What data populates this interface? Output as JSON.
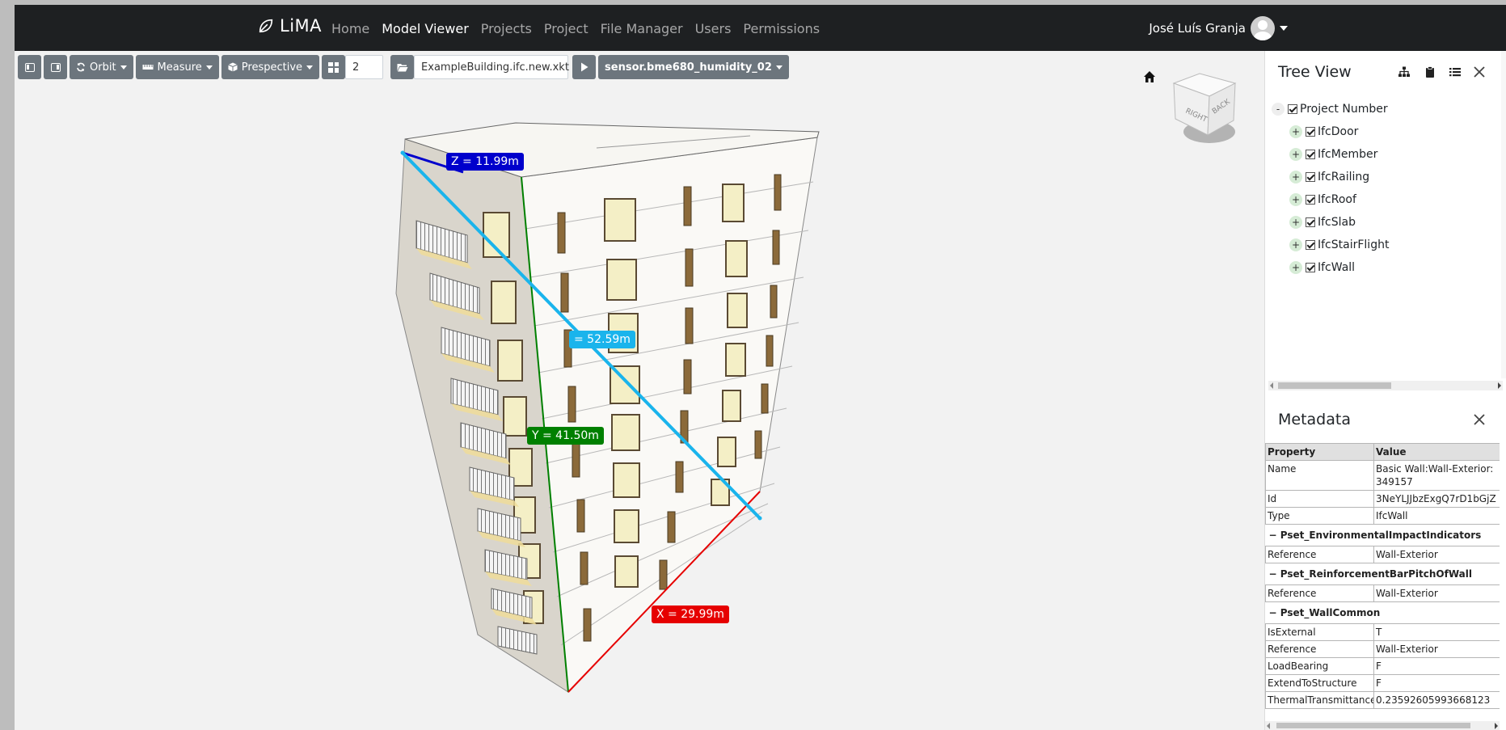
{
  "navbar": {
    "brand": "LiMA",
    "links": [
      {
        "label": "Home",
        "active": false
      },
      {
        "label": "Model Viewer",
        "active": true
      },
      {
        "label": "Projects",
        "active": false
      },
      {
        "label": "Project",
        "active": false
      },
      {
        "label": "File Manager",
        "active": false
      },
      {
        "label": "Users",
        "active": false
      },
      {
        "label": "Permissions",
        "active": false
      }
    ],
    "user_name": "José Luís Granja"
  },
  "toolbar": {
    "orbit_label": "Orbit",
    "measure_label": "Measure",
    "projection_label": "Prespective",
    "grid_count": "2",
    "file_name": "ExampleBuilding.ifc.new.xkt",
    "sensor_label": "sensor.bme680_humidity_02"
  },
  "viewport": {
    "measurements": {
      "z": "Z = 11.99m",
      "length": "= 52.59m",
      "y": "Y = 41.50m",
      "x": "X = 29.99m"
    },
    "navcube": {
      "face_right": "RIGHT",
      "face_back": "BACK"
    },
    "colors": {
      "z": "#0000cc",
      "length": "#1ab4ec",
      "y": "#008000",
      "x": "#e60000"
    }
  },
  "tree_view": {
    "title": "Tree View",
    "root": {
      "toggle": "-",
      "label": "Project Number"
    },
    "items": [
      {
        "toggle": "+",
        "label": "IfcDoor"
      },
      {
        "toggle": "+",
        "label": "IfcMember"
      },
      {
        "toggle": "+",
        "label": "IfcRailing"
      },
      {
        "toggle": "+",
        "label": "IfcRoof"
      },
      {
        "toggle": "+",
        "label": "IfcSlab"
      },
      {
        "toggle": "+",
        "label": "IfcStairFlight"
      },
      {
        "toggle": "+",
        "label": "IfcWall"
      }
    ]
  },
  "metadata": {
    "title": "Metadata",
    "headers": {
      "property": "Property",
      "value": "Value"
    },
    "rows": [
      {
        "property": "Name",
        "value": "Basic Wall:Wall-Exterior:349157"
      },
      {
        "property": "Id",
        "value": "3NeYLJJbzExgQ7rD1bGjZ"
      },
      {
        "property": "Type",
        "value": "IfcWall"
      }
    ],
    "groups": [
      {
        "name": "Pset_EnvironmentalImpactIndicators",
        "rows": [
          {
            "property": "Reference",
            "value": "Wall-Exterior"
          }
        ]
      },
      {
        "name": "Pset_ReinforcementBarPitchOfWall",
        "rows": [
          {
            "property": "Reference",
            "value": "Wall-Exterior"
          }
        ]
      },
      {
        "name": "Pset_WallCommon",
        "rows": [
          {
            "property": "IsExternal",
            "value": "T"
          },
          {
            "property": "Reference",
            "value": "Wall-Exterior"
          },
          {
            "property": "LoadBearing",
            "value": "F"
          },
          {
            "property": "ExtendToStructure",
            "value": "F"
          },
          {
            "property": "ThermalTransmittance",
            "value": "0.23592605993668123"
          }
        ]
      }
    ]
  }
}
